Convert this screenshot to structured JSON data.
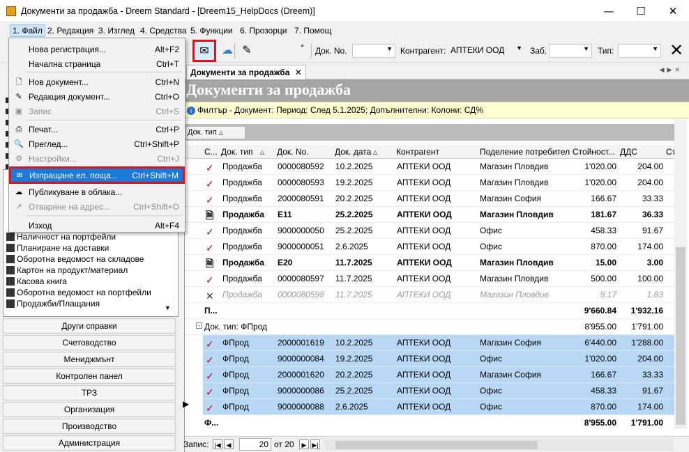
{
  "window": {
    "title": "Документи за продажба - Dreem Standard - [Dreem15_HelpDocs (Dreem)]"
  },
  "menubar": [
    "1. Файл",
    "2. Редакция",
    "3. Изглед",
    "4. Средства",
    "5. Функции",
    "6. Прозорци",
    "7. Помощ"
  ],
  "toolbar": {
    "doc_no_label": "Док. No.",
    "doc_no_value": "",
    "contragent_label": "Контрагент:",
    "contragent_value": "АПТЕКИ ООД",
    "zab_label": "Заб.",
    "zab_value": "",
    "type_label": "Тип:",
    "type_value": ""
  },
  "file_menu": [
    {
      "label": "Нова регистрация...",
      "shortcut": "Alt+F2",
      "icon": "none",
      "state": "normal"
    },
    {
      "label": "Начална страница",
      "shortcut": "Ctrl+T",
      "icon": "none",
      "state": "normal"
    },
    {
      "label": "Нов документ...",
      "shortcut": "Ctrl+N",
      "icon": "new-doc-icon",
      "state": "normal"
    },
    {
      "label": "Редакция документ...",
      "shortcut": "Ctrl+O",
      "icon": "edit-doc-icon",
      "state": "normal"
    },
    {
      "label": "Запис",
      "shortcut": "Ctrl+S",
      "icon": "save-icon",
      "state": "disabled"
    },
    {
      "label": "Печат...",
      "shortcut": "Ctrl+P",
      "icon": "print-icon",
      "state": "normal"
    },
    {
      "label": "Преглед...",
      "shortcut": "Ctrl+Shift+P",
      "icon": "preview-icon",
      "state": "normal"
    },
    {
      "label": "Настройки...",
      "shortcut": "Ctrl+J",
      "icon": "settings-icon",
      "state": "disabled"
    },
    {
      "label": "Изпращане ел. поща...",
      "shortcut": "Ctrl+Shift+M",
      "icon": "mail-icon",
      "state": "highlighted"
    },
    {
      "label": "Публикуване в облака...",
      "shortcut": "",
      "icon": "cloud-icon",
      "state": "normal"
    },
    {
      "label": "Отваряне на адрес...",
      "shortcut": "Ctrl+Shift+O",
      "icon": "link-icon",
      "state": "disabled"
    },
    {
      "label": "Изход",
      "shortcut": "Alt+F4",
      "icon": "none",
      "state": "normal"
    }
  ],
  "tree_items": [
    "Наличност на портфейли",
    "Планиране на доставки",
    "Оборотна ведомост на складове",
    "Картон на продукт/материал",
    "Касова книга",
    "Оборотна ведомост на портфейли",
    "Продажби/Плащания"
  ],
  "nav_buttons": [
    "Други справки",
    "Счетоводство",
    "Мениджмънт",
    "Контролен панел",
    "ТРЗ",
    "Организация",
    "Производство",
    "Администрация"
  ],
  "doc": {
    "tab_label": "Документи за продажба",
    "header": "Документи за продажба",
    "filter_text": "Филтър - Документ: Период: След 5.1.2025; Допълнителни: Колони: СД%",
    "group_chip": "Док. тип",
    "columns": [
      "С...",
      "Док. тип",
      "Док. No.",
      "Док. дата",
      "Контрагент",
      "Поделение потребител",
      "Стойност...",
      "ДДС",
      "Ст"
    ]
  },
  "rows": [
    {
      "status": "check",
      "type": "Продажба",
      "no": "0000080592",
      "date": "10.2.2025",
      "partner": "АПТЕКИ ООД",
      "division": "Магазин Пловдив",
      "value": "1'020.00",
      "vat": "204.00",
      "style": ""
    },
    {
      "status": "check",
      "type": "Продажба",
      "no": "0000080593",
      "date": "19.2.2025",
      "partner": "АПТЕКИ ООД",
      "division": "Магазин Пловдив",
      "value": "1'020.00",
      "vat": "204.00",
      "style": ""
    },
    {
      "status": "check",
      "type": "Продажба",
      "no": "2000080591",
      "date": "20.2.2025",
      "partner": "АПТЕКИ ООД",
      "division": "Магазин София",
      "value": "166.67",
      "vat": "33.33",
      "style": ""
    },
    {
      "status": "edit",
      "type": "Продажба",
      "no": "E11",
      "date": "25.2.2025",
      "partner": "АПТЕКИ ООД",
      "division": "Магазин Пловдив",
      "value": "181.67",
      "vat": "36.33",
      "style": "b"
    },
    {
      "status": "check",
      "type": "Продажба",
      "no": "9000000050",
      "date": "25.2.2025",
      "partner": "АПТЕКИ ООД",
      "division": "Офис",
      "value": "458.33",
      "vat": "91.67",
      "style": ""
    },
    {
      "status": "check",
      "type": "Продажба",
      "no": "9000000051",
      "date": "2.6.2025",
      "partner": "АПТЕКИ ООД",
      "division": "Офис",
      "value": "870.00",
      "vat": "174.00",
      "style": ""
    },
    {
      "status": "edit",
      "type": "Продажба",
      "no": "E20",
      "date": "11.7.2025",
      "partner": "АПТЕКИ ООД",
      "division": "Магазин Пловдив",
      "value": "15.00",
      "vat": "3.00",
      "style": "b"
    },
    {
      "status": "check",
      "type": "Продажба",
      "no": "0000080597",
      "date": "11.7.2025",
      "partner": "АПТЕКИ ООД",
      "division": "Магазин Пловдив",
      "value": "500.00",
      "vat": "100.00",
      "style": ""
    },
    {
      "status": "cross",
      "type": "Продажба",
      "no": "0000080598",
      "date": "11.7.2025",
      "partner": "АПТЕКИ ООД",
      "division": "Магазин Пловдив",
      "value": "9.17",
      "vat": "1.83",
      "style": "g"
    }
  ],
  "subtotal1": {
    "label": "П...",
    "value": "9'660.84",
    "vat": "1'932.16"
  },
  "group2": {
    "label": "Док. тип: ФПрод",
    "value": "8'955.00",
    "vat": "1'791.00"
  },
  "rows2": [
    {
      "status": "check",
      "type": "ФПрод",
      "no": "2000001619",
      "date": "10.2.2025",
      "partner": "АПТЕКИ ООД",
      "division": "Магазин София",
      "value": "6'440.00",
      "vat": "1'288.00",
      "style": "sel"
    },
    {
      "status": "check",
      "type": "ФПрод",
      "no": "9000000084",
      "date": "19.2.2025",
      "partner": "АПТЕКИ ООД",
      "division": "Офис",
      "value": "1'020.00",
      "vat": "204.00",
      "style": "sel"
    },
    {
      "status": "check",
      "type": "ФПрод",
      "no": "2000001620",
      "date": "20.2.2025",
      "partner": "АПТЕКИ ООД",
      "division": "Магазин София",
      "value": "166.67",
      "vat": "33.33",
      "style": "sel"
    },
    {
      "status": "check",
      "type": "ФПрод",
      "no": "9000000086",
      "date": "25.2.2025",
      "partner": "АПТЕКИ ООД",
      "division": "Офис",
      "value": "458.33",
      "vat": "91.67",
      "style": "sel"
    },
    {
      "status": "check",
      "type": "ФПрод",
      "no": "9000000088",
      "date": "2.6.2025",
      "partner": "АПТЕКИ ООД",
      "division": "Офис",
      "value": "870.00",
      "vat": "174.00",
      "style": "sel"
    }
  ],
  "subtotal2": {
    "label": "Ф...",
    "value": "8'955.00",
    "vat": "1'791.00"
  },
  "footer": {
    "records_label": "Запис:",
    "current": "20",
    "of_label": "от 20"
  },
  "colors": {
    "accent": "#1a7ad6",
    "highlight_border": "#e0141e",
    "selected_row": "#b8d7f4",
    "filter_bg": "#ffffd2",
    "header_bg": "#a5a5a5",
    "check": "#c00000"
  }
}
